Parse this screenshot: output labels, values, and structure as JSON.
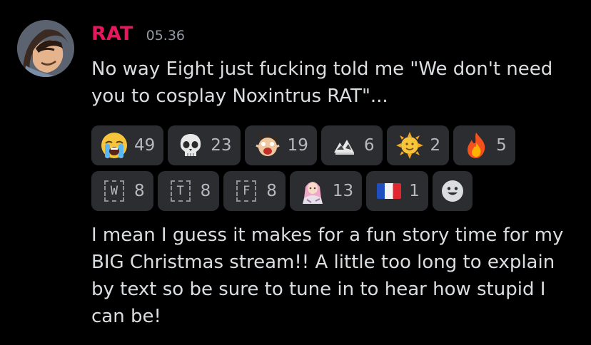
{
  "message": {
    "username": "RAT",
    "timestamp": "05.36",
    "text_1": "No way Eight just fucking told me \"We don't need you to cosplay Noxintrus RAT\"...",
    "text_2": "I mean I guess it makes for a fun story time for my BIG Christmas stream!! A little too long to explain by text so be sure to tune in to hear how stupid I can be!"
  },
  "reactions": [
    {
      "emoji": "loudly-crying-face",
      "count": "49"
    },
    {
      "emoji": "skull",
      "count": "23"
    },
    {
      "emoji": "shocked-custom-emoji",
      "count": "19"
    },
    {
      "emoji": "custom-crowd-emoji",
      "count": "6"
    },
    {
      "emoji": "sun-with-face",
      "count": "2"
    },
    {
      "emoji": "fire",
      "count": "5"
    },
    {
      "emoji": "letter-w",
      "label": "W",
      "count": "8"
    },
    {
      "emoji": "letter-t",
      "label": "T",
      "count": "8"
    },
    {
      "emoji": "letter-f",
      "label": "F",
      "count": "8"
    },
    {
      "emoji": "custom-anime-character-emoji",
      "count": "13"
    },
    {
      "emoji": "flag-france",
      "count": "1"
    }
  ],
  "colors": {
    "background": "#000000",
    "username": "#e8175d",
    "timestamp": "#949ba4",
    "text": "#dbdee1",
    "reaction_bg": "#2b2d31",
    "reaction_count": "#b5bac1"
  }
}
